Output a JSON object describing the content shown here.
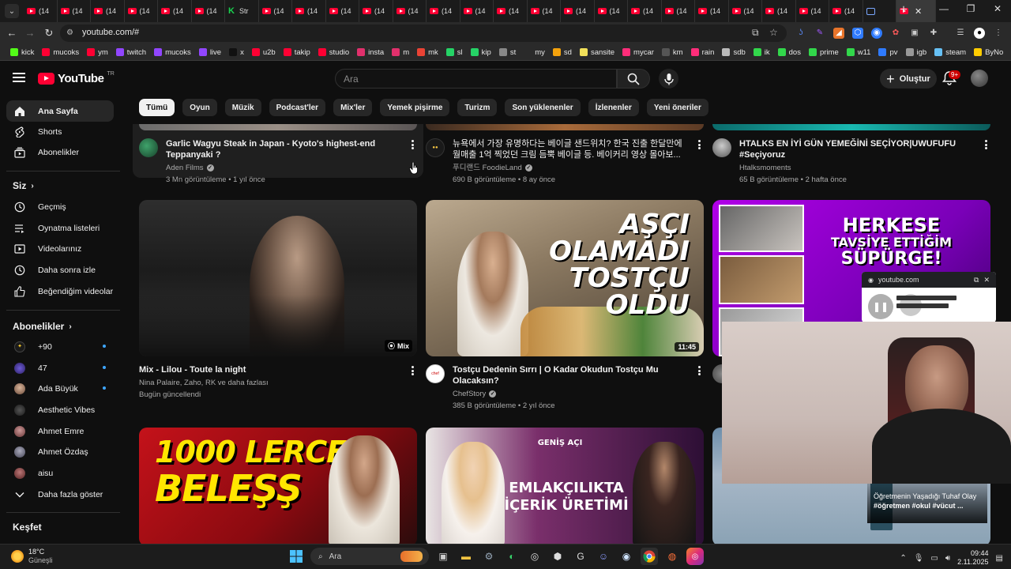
{
  "browser": {
    "tab_label": "(14",
    "tab_x_label": "Str",
    "url": "youtube.com/#",
    "bookmarks": [
      {
        "label": "kick",
        "color": "#53fc18"
      },
      {
        "label": "mucoks",
        "color": "#ff0033"
      },
      {
        "label": "ym",
        "color": "#ff0033"
      },
      {
        "label": "twitch",
        "color": "#9146ff"
      },
      {
        "label": "mucoks",
        "color": "#9146ff"
      },
      {
        "label": "live",
        "color": "#9146ff"
      },
      {
        "label": "x",
        "color": "#111111"
      },
      {
        "label": "u2b",
        "color": "#ff0033"
      },
      {
        "label": "takip",
        "color": "#ff0033"
      },
      {
        "label": "studio",
        "color": "#ff0033"
      },
      {
        "label": "insta",
        "color": "#e1306c"
      },
      {
        "label": "m",
        "color": "#e1306c"
      },
      {
        "label": "mk",
        "color": "#ea4335"
      },
      {
        "label": "sl",
        "color": "#25d366"
      },
      {
        "label": "kip",
        "color": "#25d366"
      },
      {
        "label": "st",
        "color": "#888888"
      },
      {
        "label": "my",
        "color": "#2a2a2a"
      },
      {
        "label": "sd",
        "color": "#f4a20c"
      },
      {
        "label": "sansite",
        "color": "#f1e05a"
      },
      {
        "label": "mycar",
        "color": "#ff2d7a"
      },
      {
        "label": "km",
        "color": "#555555"
      },
      {
        "label": "rain",
        "color": "#ff2d7a"
      },
      {
        "label": "sdb",
        "color": "#bbbbbb"
      },
      {
        "label": "ik",
        "color": "#32d74b"
      },
      {
        "label": "dos",
        "color": "#32d74b"
      },
      {
        "label": "prime",
        "color": "#32d74b"
      },
      {
        "label": "w11",
        "color": "#32d74b"
      },
      {
        "label": "pv",
        "color": "#2f7bff"
      },
      {
        "label": "igb",
        "color": "#999999"
      },
      {
        "label": "steam",
        "color": "#66c0f4"
      },
      {
        "label": "ByNo",
        "color": "#ffcc00"
      }
    ]
  },
  "youtube": {
    "logo_text": "YouTube",
    "logo_sup": "TR",
    "search_placeholder": "Ara",
    "create_label": "Oluştur",
    "notif_badge": "9+",
    "chips": [
      "Tümü",
      "Oyun",
      "Müzik",
      "Podcast'ler",
      "Mix'ler",
      "Yemek pişirme",
      "Turizm",
      "Son yüklenenler",
      "İzlenenler",
      "Yeni öneriler"
    ],
    "sidebar": {
      "main": [
        "Ana Sayfa",
        "Shorts",
        "Abonelikler"
      ],
      "you_header": "Siz",
      "you": [
        "Geçmiş",
        "Oynatma listeleri",
        "Videolarınız",
        "Daha sonra izle",
        "Beğendiğim videolar"
      ],
      "subs_header": "Abonelikler",
      "subs": [
        "+90",
        "47",
        "Ada Büyük",
        "Aesthetic Vibes",
        "Ahmet Emre",
        "Ahmet Özdaş",
        "aisu"
      ],
      "show_more": "Daha fazla göster",
      "explore_header": "Keşfet"
    },
    "videos_row1": [
      {
        "title": "Garlic Wagyu Steak in Japan - Kyoto's highest-end Teppanyaki ?",
        "channel": "Aden Films",
        "meta": "3 Mn görüntüleme • 1 yıl önce"
      },
      {
        "title_line1": "뉴욕에서 가장 유명하다는 베이글 샌드위치? 한국 진출 한달만에",
        "title_line2": "월매출 1억 찍었던 크림 듬뿍 베이글 등. 베이커리 영상 몰아보...",
        "channel": "푸디랜드 FoodieLand",
        "meta": "690 B görüntüleme • 8 ay önce"
      },
      {
        "title": "HTALKS EN İYİ GÜN YEMEĞİNİ SEÇİYOR|UWUFUFU #Seçiyoruz",
        "channel": "Htalksmoments",
        "meta": "65 B görüntüleme • 2 hafta önce"
      }
    ],
    "videos_row2": [
      {
        "title": "Mix - Lilou - Toute la night",
        "channel": "Nina Palaire, Zaho, RK ve daha fazlası",
        "meta": "Bugün güncellendi",
        "badge": "Mix"
      },
      {
        "title": "Tostçu Dedenin Sırrı | O Kadar Okudun Tostçu Mu Olacaksın?",
        "channel": "ChefStory",
        "meta": "385 B görüntüleme • 2 yıl önce",
        "duration": "11:45",
        "thumb_text": [
          "AŞÇI",
          "OLAMADI",
          "TOSTÇU",
          "OLDU"
        ]
      },
      {
        "thumb_text": [
          "HERKESE",
          "TAVSİYE ETTİĞİM",
          "SÜPÜRGE!"
        ]
      }
    ],
    "videos_row3": [
      {
        "thumb_text": [
          "1000 LERCE",
          "BELEŞŞ"
        ]
      },
      {
        "thumb_text": [
          "GENİŞ AÇI",
          "EMLAKÇILIKTA",
          "İÇERİK ÜRETİMİ"
        ]
      },
      {
        "overlay_title": "Öğretmenin Yaşadığı Tuhaf Olay",
        "overlay_tags": "#öğretmen #okul #vücut ..."
      }
    ],
    "pip": {
      "site": "youtube.com"
    }
  },
  "taskbar": {
    "temp": "18°C",
    "weather": "Güneşli",
    "search_label": "Ara",
    "time": "09:44",
    "date": "2.11.2025"
  }
}
